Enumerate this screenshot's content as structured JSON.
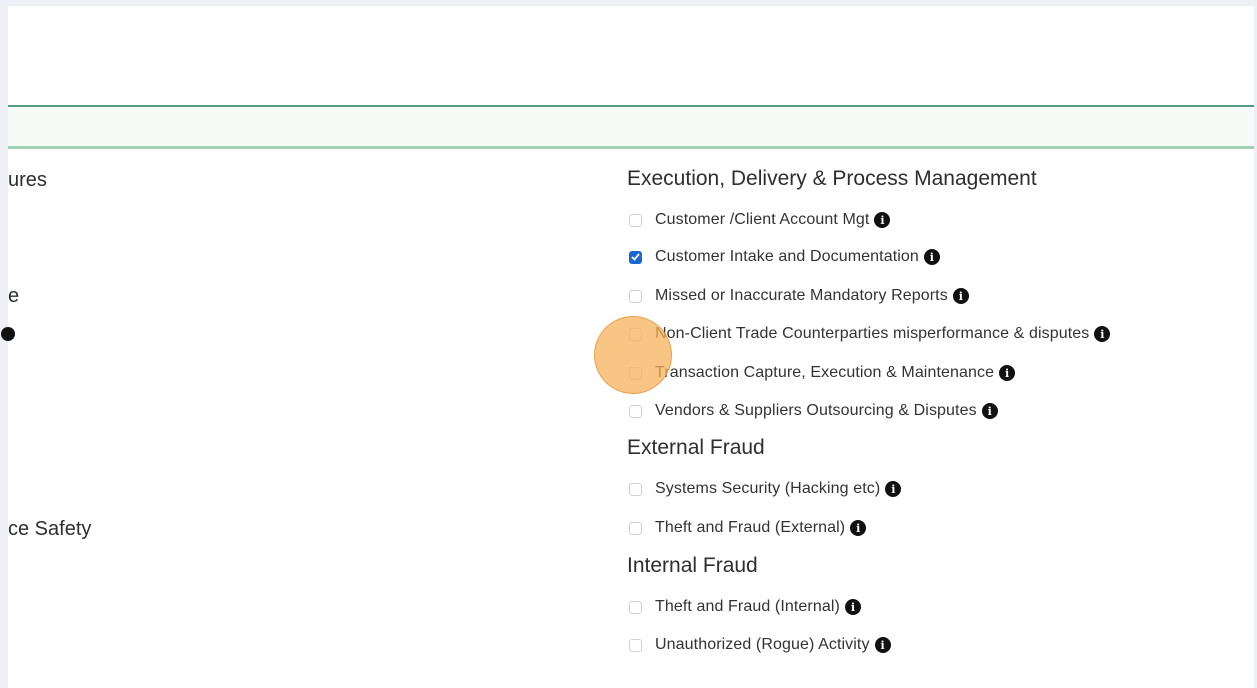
{
  "left_partial": {
    "items": [
      "ures",
      "e",
      "ce Safety"
    ]
  },
  "categories": [
    {
      "title": "Execution, Delivery & Process Management",
      "options": [
        {
          "label": "Customer /Client Account Mgt",
          "checked": false
        },
        {
          "label": "Customer Intake and Documentation",
          "checked": true
        },
        {
          "label": "Missed or Inaccurate Mandatory Reports",
          "checked": false
        },
        {
          "label": "Non-Client Trade Counterparties misperformance & disputes",
          "checked": false
        },
        {
          "label": "Transaction Capture, Execution & Maintenance",
          "checked": false
        },
        {
          "label": "Vendors & Suppliers Outsourcing & Disputes",
          "checked": false
        }
      ]
    },
    {
      "title": "External Fraud",
      "options": [
        {
          "label": "Systems Security (Hacking etc)",
          "checked": false
        },
        {
          "label": "Theft and Fraud (External)",
          "checked": false
        }
      ]
    },
    {
      "title": "Internal Fraud",
      "options": [
        {
          "label": "Theft and Fraud (Internal)",
          "checked": false
        },
        {
          "label": "Unauthorized (Rogue) Activity",
          "checked": false
        }
      ]
    }
  ],
  "icons": {
    "info": "info-icon",
    "check": "checkmark-icon"
  },
  "colors": {
    "accent_green": "#5a9b84",
    "checkbox_checked": "#1a66d2",
    "click_indicator": "#f6b25c"
  }
}
